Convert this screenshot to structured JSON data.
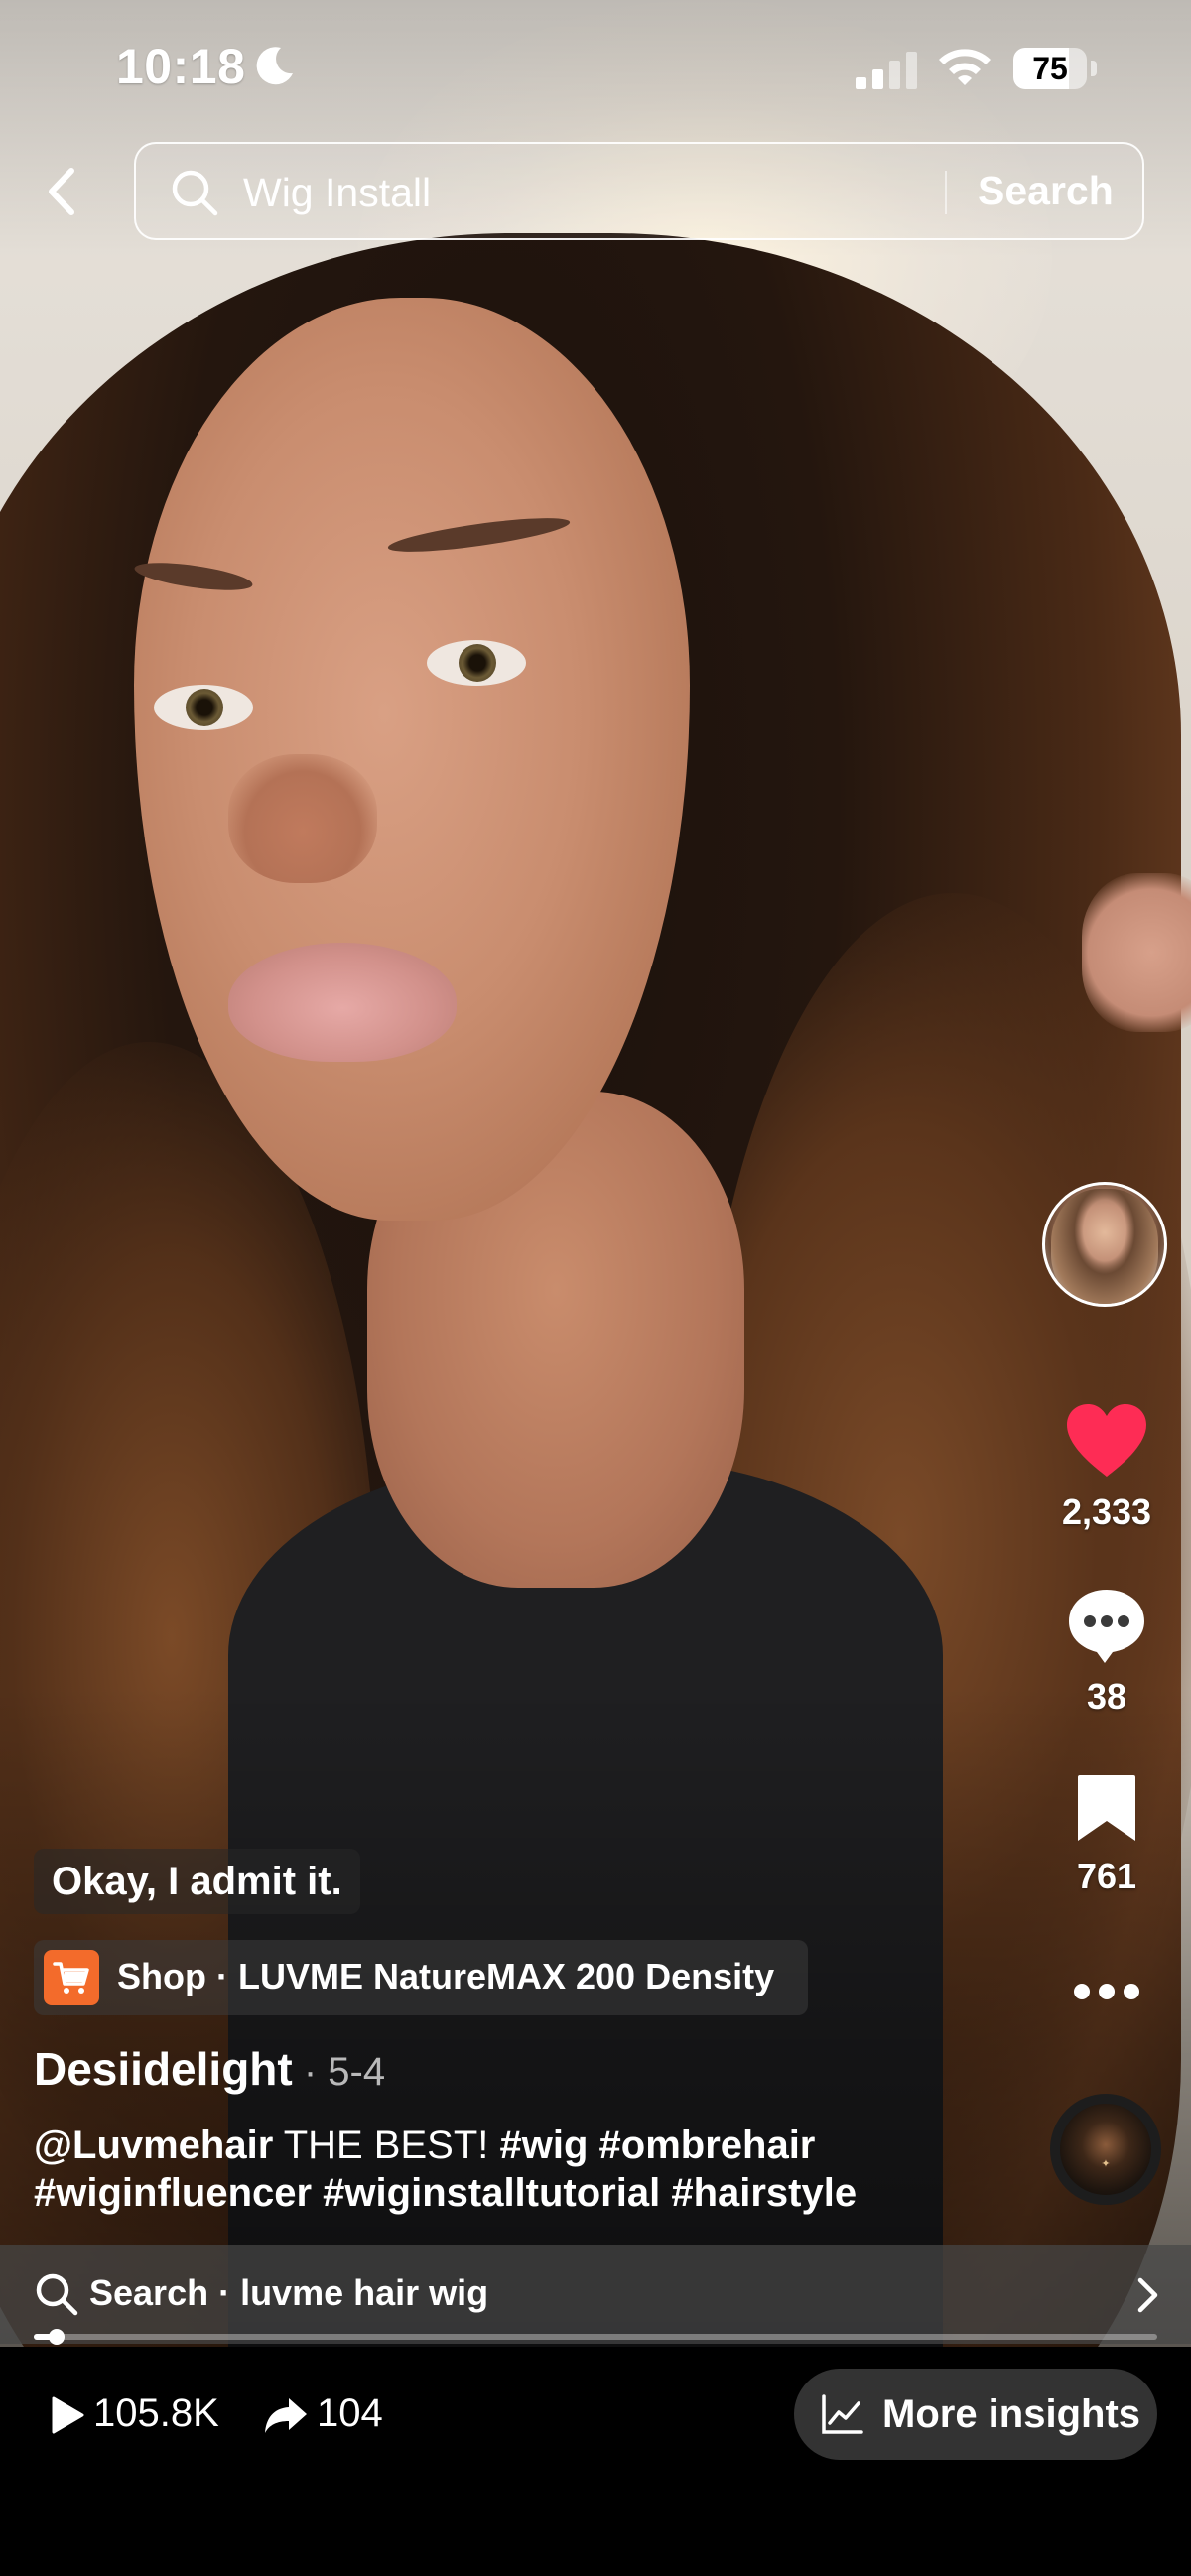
{
  "status_bar": {
    "time": "10:18",
    "battery_percent": "75",
    "battery_level": 0.75
  },
  "header": {
    "search_value": "Wig Install",
    "search_button": "Search"
  },
  "actions": {
    "likes": "2,333",
    "comments": "38",
    "saves": "761",
    "like_color": "#fe2c55"
  },
  "caption": {
    "overlay_text": "Okay, I admit it.",
    "shop_label": "Shop · LUVME NatureMAX 200 Density",
    "author": "Desiidelight",
    "date": " · 5-4",
    "mention": "@Luvmehair",
    "text": " THE BEST! ",
    "tags_line1": "#wig #ombrehair",
    "tags_line2": "#wiginfluencer #wiginstalltutorial #hairstyle"
  },
  "related_search": {
    "label": "Search · luvme hair wig"
  },
  "playback": {
    "progress": 0.02
  },
  "bottom_bar": {
    "views": "105.8K",
    "shares": "104",
    "insights_label": "More insights"
  },
  "icons": [
    "back-icon",
    "search-icon",
    "heart-icon",
    "comment-icon",
    "bookmark-icon",
    "more-icon",
    "play-icon",
    "share-icon",
    "chart-icon",
    "chevron-right-icon",
    "cart-icon",
    "moon-icon",
    "signal-icon",
    "wifi-icon"
  ]
}
